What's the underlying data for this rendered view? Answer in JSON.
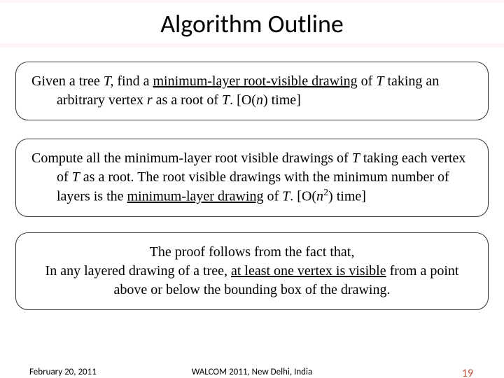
{
  "title": "Algorithm Outline",
  "box1": {
    "l1a": "Given a tree ",
    "l1b": "T, ",
    "l1c": "find a ",
    "l1d": "minimum-layer root-visible drawing",
    "l1e": " of ",
    "l1f": "T",
    "l2a": "taking an arbitrary vertex ",
    "l2b": "r",
    "l2c": " as a root of ",
    "l2d": "T",
    "l2e": ".  [O(",
    "l2f": "n",
    "l2g": ") time]"
  },
  "box2": {
    "l1a": "Compute all the minimum-layer root visible drawings of ",
    "l1b": "T",
    "l1c": " taking each vertex of ",
    "l1d": "T",
    "l1e": " as a root. The  root visible drawings with the  minimum number of layers is the ",
    "l1f": "minimum-layer drawing",
    "l1g": " of ",
    "l1h": "T",
    "l1i": ". [O(",
    "l1j": "n",
    "l1k": "2",
    "l1l": ") time]"
  },
  "box3": {
    "l1": "The proof follows from the fact that,",
    "l2a": "In any layered drawing of a tree, ",
    "l2b": "at least one vertex is visible",
    "l2c": " from a point above or below the bounding box of the drawing."
  },
  "footer": {
    "date": "February 20, 2011",
    "venue": "WALCOM 2011, New Delhi, India",
    "page": "19"
  }
}
